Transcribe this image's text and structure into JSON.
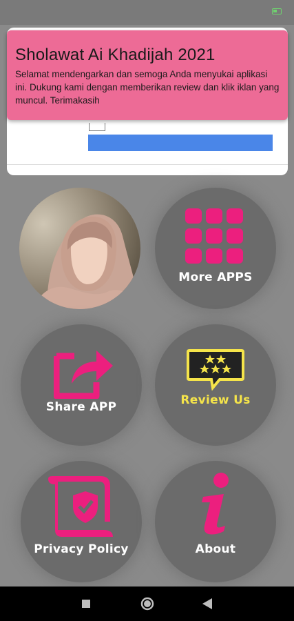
{
  "banner": {
    "title": "Sholawat Ai Khadijah 2021",
    "message": "Selamat mendengarkan dan semoga Anda menyukai aplikasi ini. Dukung kami dengan memberikan review dan klik iklan yang muncul. Terimakasih"
  },
  "tiles": {
    "more_apps": "More APPS",
    "share_app": "Share APP",
    "review_us": "Review Us",
    "privacy_policy": "Privacy Policy",
    "about": "About"
  },
  "colors": {
    "accent": "#ec1f7e",
    "banner": "#ed6b96",
    "review_yellow": "#f5e44a",
    "tile": "#6b6b6b"
  },
  "icons": {
    "more_apps": "grid-icon",
    "share_app": "share-icon",
    "review_us": "star-rating-icon",
    "privacy_policy": "shield-scroll-icon",
    "about": "info-icon",
    "nav_back": "back-icon",
    "nav_home": "home-icon",
    "nav_recent": "recent-apps-icon"
  }
}
